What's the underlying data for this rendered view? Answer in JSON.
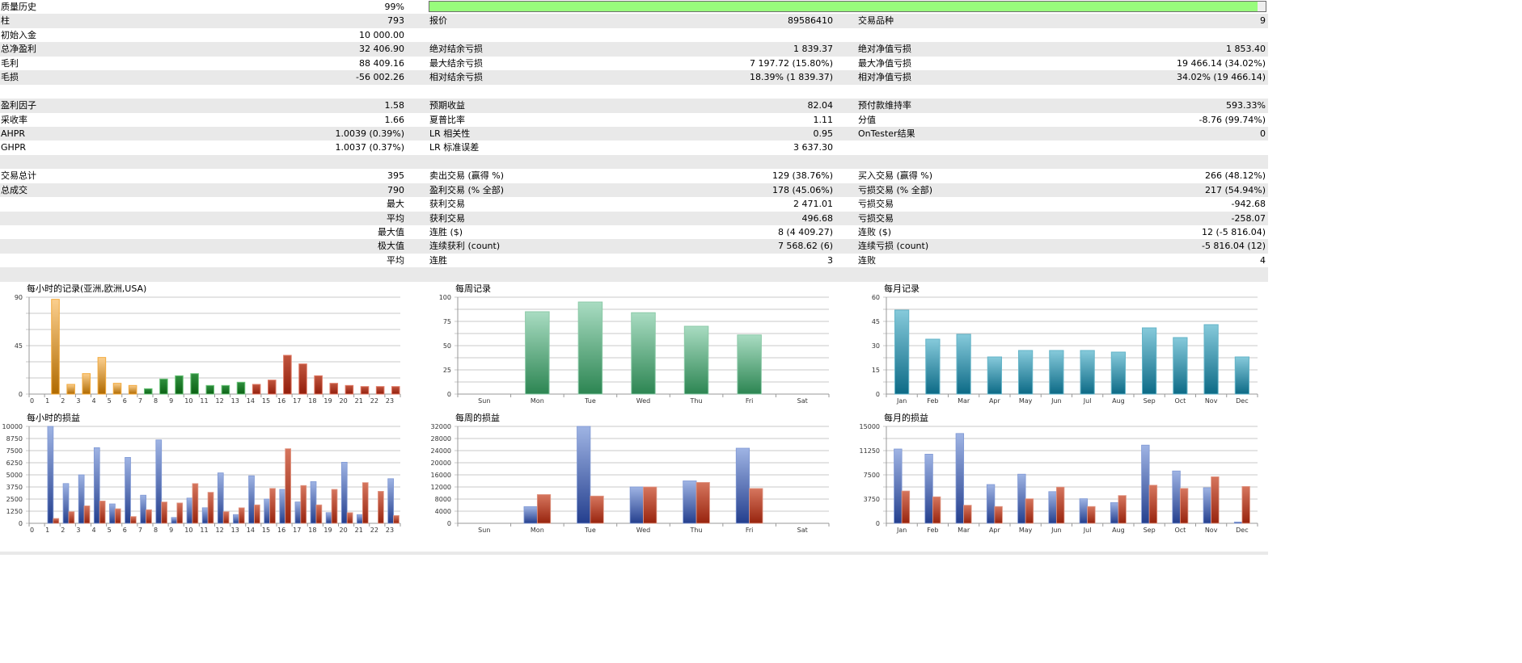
{
  "quality": {
    "label": "质量历史",
    "value": "99%",
    "fraction": 0.99
  },
  "rows": [
    [
      "柱",
      "793",
      "报价",
      "89586410",
      "交易品种",
      "9"
    ],
    [
      "初始入金",
      "10 000.00",
      "",
      "",
      "",
      ""
    ],
    [
      "总净盈利",
      "32 406.90",
      "绝对结余亏损",
      "1 839.37",
      "绝对净值亏损",
      "1 853.40"
    ],
    [
      "毛利",
      "88 409.16",
      "最大结余亏损",
      "7 197.72 (15.80%)",
      "最大净值亏损",
      "19 466.14 (34.02%)"
    ],
    [
      "毛损",
      "-56 002.26",
      "相对结余亏损",
      "18.39% (1 839.37)",
      "相对净值亏损",
      "34.02% (19 466.14)"
    ],
    [
      "",
      "",
      "",
      "",
      "",
      ""
    ],
    [
      "盈利因子",
      "1.58",
      "预期收益",
      "82.04",
      "预付款维持率",
      "593.33%"
    ],
    [
      "采收率",
      "1.66",
      "夏普比率",
      "1.11",
      "分值",
      "-8.76 (99.74%)"
    ],
    [
      "AHPR",
      "1.0039 (0.39%)",
      "LR 相关性",
      "0.95",
      "OnTester结果",
      "0"
    ],
    [
      "GHPR",
      "1.0037 (0.37%)",
      "LR 标准误差",
      "3 637.30",
      "",
      ""
    ],
    [
      "",
      "",
      "",
      "",
      "",
      ""
    ],
    [
      "交易总计",
      "395",
      "卖出交易 (赢得 %)",
      "129 (38.76%)",
      "买入交易 (赢得 %)",
      "266 (48.12%)"
    ],
    [
      "总成交",
      "790",
      "盈利交易 (% 全部)",
      "178 (45.06%)",
      "亏损交易 (% 全部)",
      "217 (54.94%)"
    ],
    [
      "",
      "最大",
      "获利交易",
      "2 471.01",
      "亏损交易",
      "-942.68"
    ],
    [
      "",
      "平均",
      "获利交易",
      "496.68",
      "亏损交易",
      "-258.07"
    ],
    [
      "",
      "最大值",
      "连胜 ($)",
      "8 (4 409.27)",
      "连败 ($)",
      "12 (-5 816.04)"
    ],
    [
      "",
      "极大值",
      "连续获利 (count)",
      "7 568.62 (6)",
      "连续亏损 (count)",
      "-5 816.04 (12)"
    ],
    [
      "",
      "平均",
      "连胜",
      "3",
      "连败",
      "4"
    ],
    [
      "",
      "",
      "",
      "",
      "",
      ""
    ]
  ],
  "colors": {
    "grid": "#c8c8c8",
    "axis": "#999999",
    "progress": "#98fc7c"
  },
  "chart_data": [
    {
      "id": "hourly-count",
      "type": "bar",
      "title": "每小时的记录(亚洲,欧洲,USA)",
      "ylim": [
        0,
        90
      ],
      "yticks": [
        "0",
        "45",
        "90"
      ],
      "grid_steps": 6,
      "label_align": "left",
      "categories": [
        "0",
        "1",
        "2",
        "3",
        "4",
        "5",
        "6",
        "7",
        "8",
        "9",
        "10",
        "11",
        "12",
        "13",
        "14",
        "15",
        "16",
        "17",
        "18",
        "19",
        "20",
        "21",
        "22",
        "23"
      ],
      "values": [
        0,
        88,
        9,
        19,
        34,
        10,
        8,
        5,
        14,
        17,
        19,
        8,
        8,
        11,
        9,
        13,
        36,
        28,
        17,
        10,
        8,
        7,
        7,
        7
      ],
      "groups": [
        "asia",
        "asia",
        "asia",
        "asia",
        "asia",
        "asia",
        "asia",
        "europe",
        "europe",
        "europe",
        "europe",
        "europe",
        "europe",
        "europe",
        "usa",
        "usa",
        "usa",
        "usa",
        "usa",
        "usa",
        "usa",
        "usa",
        "usa",
        "usa"
      ]
    },
    {
      "id": "weekly-count",
      "type": "bar",
      "title": "每周记录",
      "ylim": [
        0,
        100
      ],
      "yticks": [
        "0",
        "25",
        "50",
        "75",
        "100"
      ],
      "grid_steps": 8,
      "label_align": "center",
      "categories": [
        "Sun",
        "Mon",
        "Tue",
        "Wed",
        "Thu",
        "Fri",
        "Sat"
      ],
      "values": [
        0,
        85,
        95,
        84,
        70,
        61,
        0
      ],
      "groups": "week"
    },
    {
      "id": "monthly-count",
      "type": "bar",
      "title": "每月记录",
      "ylim": [
        0,
        60
      ],
      "yticks": [
        "0",
        "15",
        "30",
        "45",
        "60"
      ],
      "grid_steps": 8,
      "label_align": "center",
      "categories": [
        "Jan",
        "Feb",
        "Mar",
        "Apr",
        "May",
        "Jun",
        "Jul",
        "Aug",
        "Sep",
        "Oct",
        "Nov",
        "Dec"
      ],
      "values": [
        52,
        34,
        37,
        23,
        27,
        27,
        27,
        26,
        41,
        35,
        43,
        23
      ],
      "groups": "month"
    },
    {
      "id": "hourly-pl",
      "type": "bar",
      "title": "每小时的损益",
      "ylim": [
        0,
        10000
      ],
      "yticks": [
        "0",
        "1250",
        "2500",
        "3750",
        "5000",
        "6250",
        "7500",
        "8750",
        "10000"
      ],
      "grid_steps": 8,
      "label_align": "left",
      "categories": [
        "0",
        "1",
        "2",
        "3",
        "4",
        "5",
        "6",
        "7",
        "8",
        "9",
        "10",
        "11",
        "12",
        "13",
        "14",
        "15",
        "16",
        "17",
        "18",
        "19",
        "20",
        "21",
        "22",
        "23"
      ],
      "series": [
        {
          "name": "profit",
          "values": [
            0,
            10000,
            4100,
            5000,
            7800,
            2000,
            6800,
            2900,
            8600,
            600,
            2600,
            1600,
            5200,
            900,
            4900,
            2500,
            3500,
            2200,
            4300,
            1100,
            6300,
            900,
            0,
            4600
          ]
        },
        {
          "name": "loss",
          "values": [
            0,
            500,
            1200,
            1800,
            2300,
            1500,
            700,
            1400,
            2200,
            2100,
            4100,
            3200,
            1200,
            1600,
            1900,
            3600,
            7700,
            3900,
            1900,
            3500,
            1100,
            4200,
            3300,
            800
          ]
        }
      ]
    },
    {
      "id": "weekly-pl",
      "type": "bar",
      "title": "每周的损益",
      "ylim": [
        0,
        32000
      ],
      "yticks": [
        "0",
        "4000",
        "8000",
        "12000",
        "16000",
        "20000",
        "24000",
        "28000",
        "32000"
      ],
      "grid_steps": 8,
      "label_align": "center",
      "categories": [
        "Sun",
        "Mon",
        "Tue",
        "Wed",
        "Thu",
        "Fri",
        "Sat"
      ],
      "series": [
        {
          "name": "profit",
          "values": [
            0,
            5500,
            32000,
            12000,
            14000,
            24800,
            0
          ]
        },
        {
          "name": "loss",
          "values": [
            0,
            9500,
            9000,
            12000,
            13500,
            11500,
            0
          ]
        }
      ]
    },
    {
      "id": "monthly-pl",
      "type": "bar",
      "title": "每月的损益",
      "ylim": [
        0,
        15000
      ],
      "yticks": [
        "0",
        "3750",
        "7500",
        "11250",
        "15000"
      ],
      "grid_steps": 8,
      "label_align": "center",
      "categories": [
        "Jan",
        "Feb",
        "Mar",
        "Apr",
        "May",
        "Jun",
        "Jul",
        "Aug",
        "Sep",
        "Oct",
        "Nov",
        "Dec"
      ],
      "series": [
        {
          "name": "profit",
          "values": [
            11500,
            10700,
            13900,
            6000,
            7600,
            4900,
            3800,
            3200,
            12100,
            8100,
            5500,
            200
          ]
        },
        {
          "name": "loss",
          "values": [
            5000,
            4100,
            2800,
            2600,
            3800,
            5600,
            2600,
            4300,
            5900,
            5400,
            7200,
            5700
          ]
        }
      ]
    }
  ]
}
